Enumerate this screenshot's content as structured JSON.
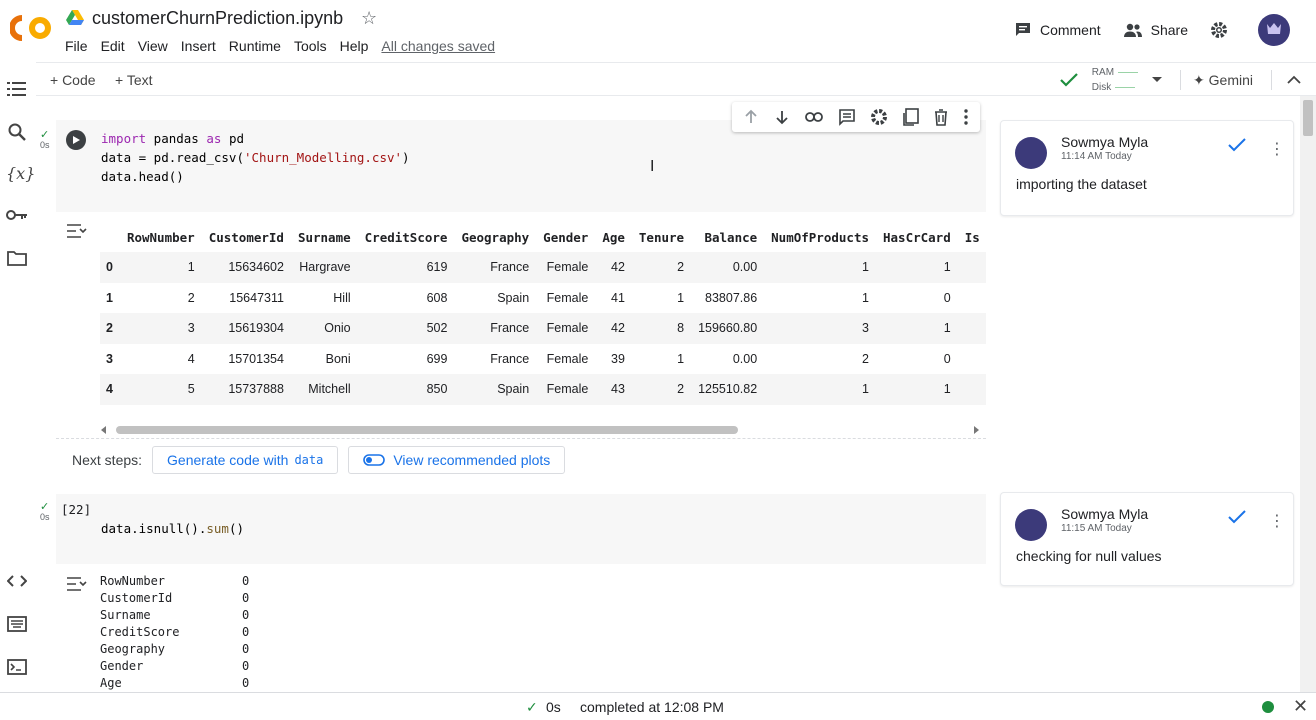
{
  "header": {
    "title": "customerChurnPrediction.ipynb",
    "menu": [
      "File",
      "Edit",
      "View",
      "Insert",
      "Runtime",
      "Tools",
      "Help"
    ],
    "saved_status": "All changes saved",
    "comment_label": "Comment",
    "share_label": "Share"
  },
  "toolbar": {
    "add_code": "+ Code",
    "add_text": "+ Text",
    "ram_label": "RAM",
    "disk_label": "Disk",
    "gemini_label": "✦ Gemini"
  },
  "cell1": {
    "exec_time": "0s",
    "lines": [
      [
        [
          "kw",
          "import"
        ],
        [
          "pl",
          " pandas "
        ],
        [
          "kw",
          "as"
        ],
        [
          "pl",
          " pd"
        ]
      ],
      [
        [
          "pl",
          "data = pd.read_csv("
        ],
        [
          "str",
          "'Churn_Modelling.csv'"
        ],
        [
          "pl",
          ")"
        ]
      ],
      [
        [
          "pl",
          "data.head()"
        ]
      ]
    ],
    "table": {
      "columns": [
        "",
        "RowNumber",
        "CustomerId",
        "Surname",
        "CreditScore",
        "Geography",
        "Gender",
        "Age",
        "Tenure",
        "Balance",
        "NumOfProducts",
        "HasCrCard",
        "Is"
      ],
      "rows": [
        [
          "0",
          "1",
          "15634602",
          "Hargrave",
          "619",
          "France",
          "Female",
          "42",
          "2",
          "0.00",
          "1",
          "1",
          ""
        ],
        [
          "1",
          "2",
          "15647311",
          "Hill",
          "608",
          "Spain",
          "Female",
          "41",
          "1",
          "83807.86",
          "1",
          "0",
          ""
        ],
        [
          "2",
          "3",
          "15619304",
          "Onio",
          "502",
          "France",
          "Female",
          "42",
          "8",
          "159660.80",
          "3",
          "1",
          ""
        ],
        [
          "3",
          "4",
          "15701354",
          "Boni",
          "699",
          "France",
          "Female",
          "39",
          "1",
          "0.00",
          "2",
          "0",
          ""
        ],
        [
          "4",
          "5",
          "15737888",
          "Mitchell",
          "850",
          "Spain",
          "Female",
          "43",
          "2",
          "125510.82",
          "1",
          "1",
          ""
        ]
      ]
    },
    "next_steps_label": "Next steps:",
    "chip_generate": "Generate code with",
    "chip_generate_code": "data",
    "chip_plots": "View recommended plots"
  },
  "cell2": {
    "exec_count": "[22]",
    "exec_time": "0s",
    "line": [
      [
        "pl",
        "data.isnull()."
      ],
      [
        "fn",
        "sum"
      ],
      [
        "pl",
        "()"
      ]
    ],
    "output": [
      [
        "RowNumber",
        "0"
      ],
      [
        "CustomerId",
        "0"
      ],
      [
        "Surname",
        "0"
      ],
      [
        "CreditScore",
        "0"
      ],
      [
        "Geography",
        "0"
      ],
      [
        "Gender",
        "0"
      ],
      [
        "Age",
        "0"
      ]
    ]
  },
  "comments": [
    {
      "author": "Sowmya Myla",
      "time": "11:14 AM Today",
      "text": "importing the dataset"
    },
    {
      "author": "Sowmya Myla",
      "time": "11:15 AM Today",
      "text": "checking for null values"
    }
  ],
  "status": {
    "duration": "0s",
    "completed": "completed at 12:08 PM"
  },
  "colors": {
    "accent": "#1a73e8",
    "success": "#1e8e3e",
    "logo_orange": "#f9ab00",
    "logo_dark": "#e8710a"
  }
}
